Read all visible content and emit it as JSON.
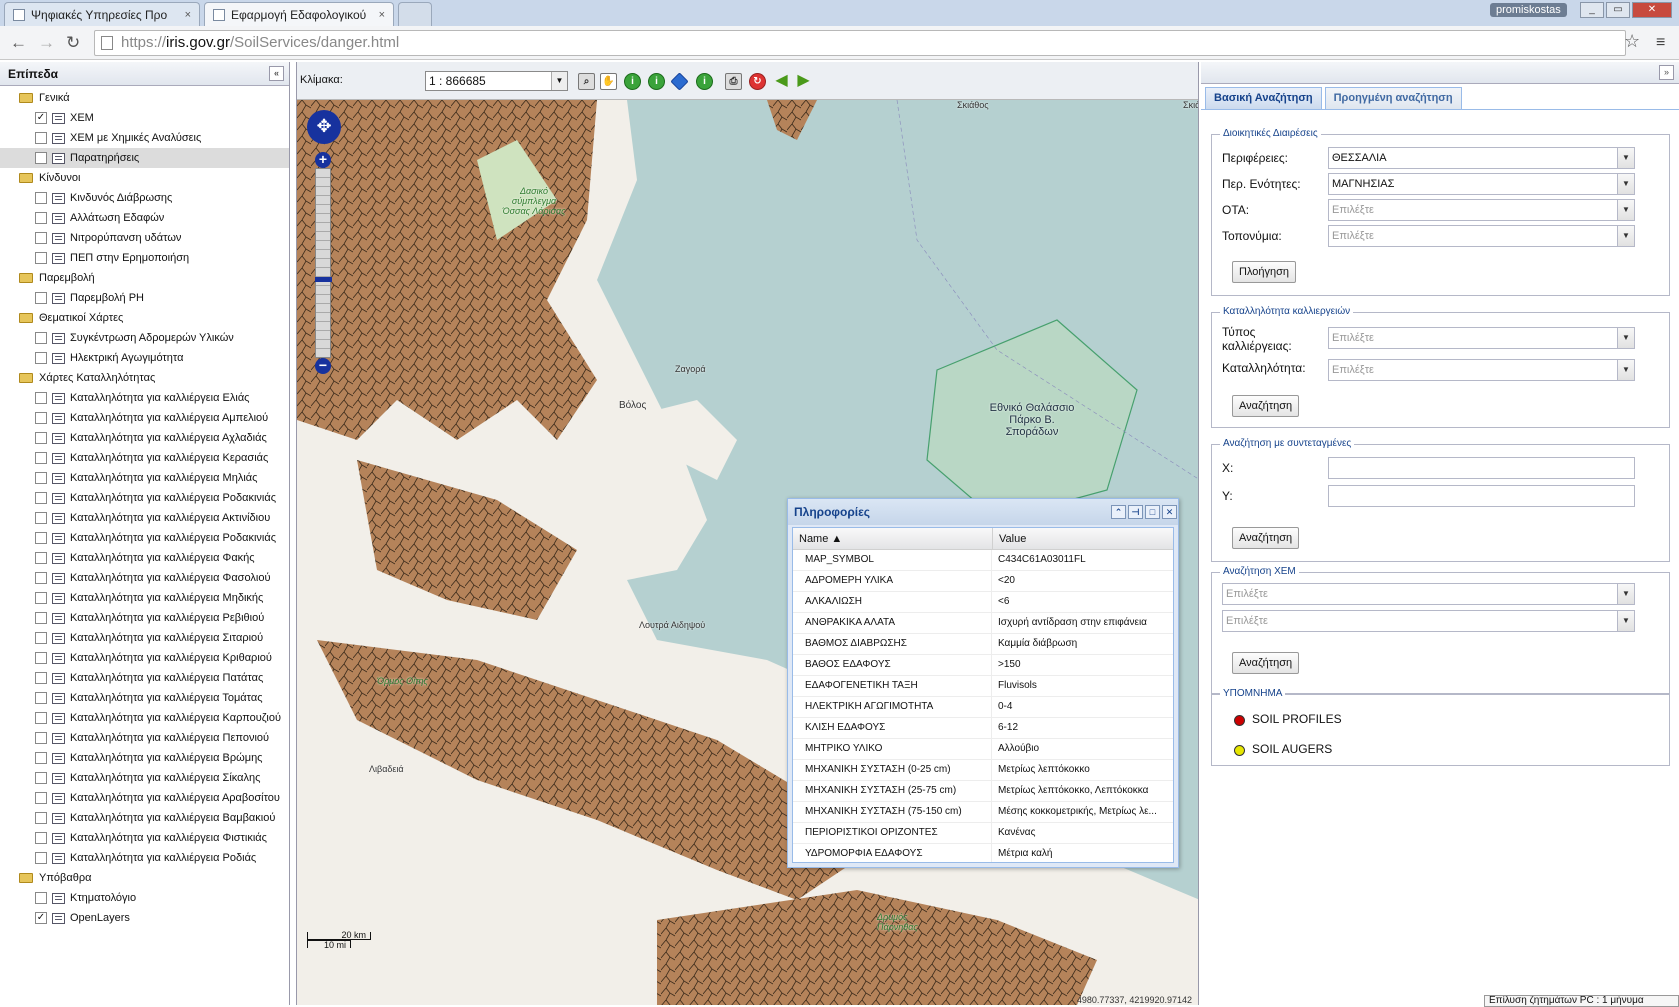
{
  "browser": {
    "tabs": [
      {
        "label": "Ψηφιακές Υπηρεσίες Προ",
        "close": "×"
      },
      {
        "label": "Εφαρμογή Εδαφολογικού",
        "close": "×"
      }
    ],
    "user": "promiskostas",
    "url_prefix": "https://",
    "url_host": "iris.gov.gr",
    "url_path": "/SoilServices/danger.html",
    "window_buttons": [
      "_",
      "▭",
      "✕"
    ]
  },
  "layers": {
    "title": "Επίπεδα",
    "collapse": "«",
    "items": [
      {
        "type": "folder",
        "label": "Γενικά"
      },
      {
        "type": "layer",
        "label": "ΧΕΜ",
        "checked": "✓"
      },
      {
        "type": "layer",
        "label": "ΧΕΜ με Χημικές Αναλύσεις",
        "checked": ""
      },
      {
        "type": "layer",
        "label": "Παρατηρήσεις",
        "checked": "",
        "selected": true
      },
      {
        "type": "folder",
        "label": "Κίνδυνοι"
      },
      {
        "type": "layer",
        "label": "Κινδυνός Διάβρωσης",
        "checked": ""
      },
      {
        "type": "layer",
        "label": "Αλλάτωση Εδαφών",
        "checked": ""
      },
      {
        "type": "layer",
        "label": "Νιτρορύπανση υδάτων",
        "checked": ""
      },
      {
        "type": "layer",
        "label": "ΠΕΠ στην Ερημοποιήση",
        "checked": ""
      },
      {
        "type": "folder",
        "label": "Παρεμβολή"
      },
      {
        "type": "layer",
        "label": "Παρεμβολή PH",
        "checked": ""
      },
      {
        "type": "folder",
        "label": "Θεματικοί Χάρτες"
      },
      {
        "type": "layer",
        "label": "Συγκέντρωση Αδρομερών Υλικών",
        "checked": ""
      },
      {
        "type": "layer",
        "label": "Ηλεκτρική Αγωγιμότητα",
        "checked": ""
      },
      {
        "type": "folder",
        "label": "Χάρτες Καταλληλότητας"
      },
      {
        "type": "layer",
        "label": "Καταλληλότητα για καλλιέργεια Ελιάς",
        "checked": ""
      },
      {
        "type": "layer",
        "label": "Καταλληλότητα για καλλιέργεια Αμπελιού",
        "checked": ""
      },
      {
        "type": "layer",
        "label": "Καταλληλότητα για καλλιέργεια Αχλαδιάς",
        "checked": ""
      },
      {
        "type": "layer",
        "label": "Καταλληλότητα για καλλιέργεια Κερασιάς",
        "checked": ""
      },
      {
        "type": "layer",
        "label": "Καταλληλότητα για καλλιέργεια Μηλιάς",
        "checked": ""
      },
      {
        "type": "layer",
        "label": "Καταλληλότητα για καλλιέργεια Ροδακινιάς",
        "checked": ""
      },
      {
        "type": "layer",
        "label": "Καταλληλότητα για καλλιέργεια Ακτινίδιου",
        "checked": ""
      },
      {
        "type": "layer",
        "label": "Καταλληλότητα για καλλιέργεια Ροδακινιάς",
        "checked": ""
      },
      {
        "type": "layer",
        "label": "Καταλληλότητα για καλλιέργεια Φακής",
        "checked": ""
      },
      {
        "type": "layer",
        "label": "Καταλληλότητα για καλλιέργεια Φασολιού",
        "checked": ""
      },
      {
        "type": "layer",
        "label": "Καταλληλότητα για καλλιέργεια Μηδικής",
        "checked": ""
      },
      {
        "type": "layer",
        "label": "Καταλληλότητα για καλλιέργεια Ρεβιθιού",
        "checked": ""
      },
      {
        "type": "layer",
        "label": "Καταλληλότητα για καλλιέργεια Σιταριού",
        "checked": ""
      },
      {
        "type": "layer",
        "label": "Καταλληλότητα για καλλιέργεια Κριθαριού",
        "checked": ""
      },
      {
        "type": "layer",
        "label": "Καταλληλότητα για καλλιέργεια Πατάτας",
        "checked": ""
      },
      {
        "type": "layer",
        "label": "Καταλληλότητα για καλλιέργεια Τομάτας",
        "checked": ""
      },
      {
        "type": "layer",
        "label": "Καταλληλότητα για καλλιέργεια Καρπουζιού",
        "checked": ""
      },
      {
        "type": "layer",
        "label": "Καταλληλότητα για καλλιέργεια Πεπονιού",
        "checked": ""
      },
      {
        "type": "layer",
        "label": "Καταλληλότητα για καλλιέργεια Βρώμης",
        "checked": ""
      },
      {
        "type": "layer",
        "label": "Καταλληλότητα για καλλιέργεια Σίκαλης",
        "checked": ""
      },
      {
        "type": "layer",
        "label": "Καταλληλότητα για καλλιέργεια Αραβοσίτου",
        "checked": ""
      },
      {
        "type": "layer",
        "label": "Καταλληλότητα για καλλιέργεια Βαμβακιού",
        "checked": ""
      },
      {
        "type": "layer",
        "label": "Καταλληλότητα για καλλιέργεια Φιστικιάς",
        "checked": ""
      },
      {
        "type": "layer",
        "label": "Καταλληλότητα για καλλιέργεια Ροδιάς",
        "checked": ""
      },
      {
        "type": "folder",
        "label": "Υπόβαθρα"
      },
      {
        "type": "layer",
        "label": "Κτηματολόγιο",
        "checked": ""
      },
      {
        "type": "layer",
        "label": "OpenLayers",
        "checked": "✓"
      }
    ]
  },
  "map": {
    "scale_label": "Κλίμακα:",
    "scale_value": "1 : 866685",
    "scalebar_km": "20 km",
    "scalebar_mi": "10 mi",
    "coords": "4980.77337, 4219920.97142",
    "labels": [
      {
        "text": "Σκιάθος"
      },
      {
        "text": "Δασικό σύμπλεγμα Όσσας Λάρισας"
      },
      {
        "text": "Ζαγορά"
      },
      {
        "text": "Βόλος"
      },
      {
        "text": "Λουτρά Αιδηψού"
      },
      {
        "text": "Όρμος Οίτης"
      },
      {
        "text": "Λιβαδειά"
      },
      {
        "text": "Δρυμός Πάρνηθας"
      },
      {
        "text": "Εθνικό Θαλάσσιο Πάρκο Β. Σποράδων"
      },
      {
        "text": "Σκιά"
      }
    ]
  },
  "popup": {
    "title": "Πληροφορίες",
    "col_name": "Name ▲",
    "col_value": "Value",
    "rows": [
      {
        "name": "MAP_SYMBOL",
        "value": "C434C61A03011FL"
      },
      {
        "name": "ΑΔΡΟΜΕΡΗ ΥΛΙΚΑ",
        "value": "<20"
      },
      {
        "name": "ΑΛΚΑΛΙΩΣΗ",
        "value": "<6"
      },
      {
        "name": "ΑΝΘΡΑΚΙΚΑ ΑΛΑΤΑ",
        "value": "Ισχυρή αντίδραση στην επιφάνεια"
      },
      {
        "name": "ΒΑΘΜΟΣ ΔΙΑΒΡΩΣΗΣ",
        "value": "Καμμία διάβρωση"
      },
      {
        "name": "ΒΑΘΟΣ ΕΔΑΦΟΥΣ",
        "value": ">150"
      },
      {
        "name": "ΕΔΑΦΟΓΕΝΕΤΙΚΗ ΤΑΞΗ",
        "value": "Fluvisols"
      },
      {
        "name": "ΗΛΕΚΤΡΙΚΗ ΑΓΩΓΙΜΟΤΗΤΑ",
        "value": "0-4"
      },
      {
        "name": "ΚΛΙΣΗ ΕΔΑΦΟΥΣ",
        "value": "6-12"
      },
      {
        "name": "ΜΗΤΡΙΚΟ ΥΛΙΚΟ",
        "value": "Αλλούβιο"
      },
      {
        "name": "ΜΗΧΑΝΙΚΗ ΣΥΣΤΑΣΗ (0-25 cm)",
        "value": "Μετρίως λεπτόκοκκο"
      },
      {
        "name": "ΜΗΧΑΝΙΚΗ ΣΥΣΤΑΣΗ (25-75 cm)",
        "value": "Μετρίως λεπτόκοκκο, Λεπτόκοκκα"
      },
      {
        "name": "ΜΗΧΑΝΙΚΗ ΣΥΣΤΑΣΗ (75-150 cm)",
        "value": "Μέσης κοκκομετρικής, Μετρίως λε..."
      },
      {
        "name": "ΠΕΡΙΟΡΙΣΤΙΚΟΙ ΟΡΙΖΟΝΤΕΣ",
        "value": "Κανένας"
      },
      {
        "name": "ΥΔΡΟΜΟΡΦΙΑ ΕΔΑΦΟΥΣ",
        "value": "Μέτρια καλή"
      }
    ]
  },
  "search": {
    "tab_basic": "Βασική Αναζήτηση",
    "tab_advanced": "Προηγμένη αναζήτηση",
    "admin": {
      "legend": "Διοικητικές Διαιρέσεις",
      "region_label": "Περιφέρειες:",
      "region_value": "ΘΕΣΣΑΛΙΑ",
      "unit_label": "Περ. Ενότητες:",
      "unit_value": "ΜΑΓΝΗΣΙΑΣ",
      "ota_label": "ΟΤΑ:",
      "ota_placeholder": "Επιλέξτε",
      "place_label": "Τοπονύμια:",
      "place_placeholder": "Επιλέξτε",
      "button": "Πλοήγηση"
    },
    "crop": {
      "legend": "Καταλληλότητα καλλιεργειών",
      "type_label_1": "Τύπος",
      "type_label_2": "καλλιέργειας:",
      "type_placeholder": "Επιλέξτε",
      "suit_label": "Καταλληλότητα:",
      "suit_placeholder": "Επιλέξτε",
      "button": "Αναζήτηση"
    },
    "coords": {
      "legend": "Αναζήτηση με συντεταγμένες",
      "x_label": "X:",
      "y_label": "Y:",
      "button": "Αναζήτηση"
    },
    "xem": {
      "legend": "Αναζήτηση ΧΕΜ",
      "placeholder1": "Επιλέξτε",
      "placeholder2": "Επιλέξτε",
      "button": "Αναζήτηση"
    },
    "legend": {
      "legend": "ΥΠΟΜΝΗΜΑ",
      "items": [
        {
          "label": "SOIL PROFILES",
          "color": "#cc0000"
        },
        {
          "label": "SOIL AUGERS",
          "color": "#e6e600"
        }
      ]
    }
  },
  "status": "Επίλυση ζητημάτων PC : 1 μήνυμα",
  "colors": {
    "polygon_fill": "#b5835a",
    "polygon_stroke": "#3a2a1a",
    "sea": "#b5d0d0",
    "land": "#f2efe9"
  }
}
